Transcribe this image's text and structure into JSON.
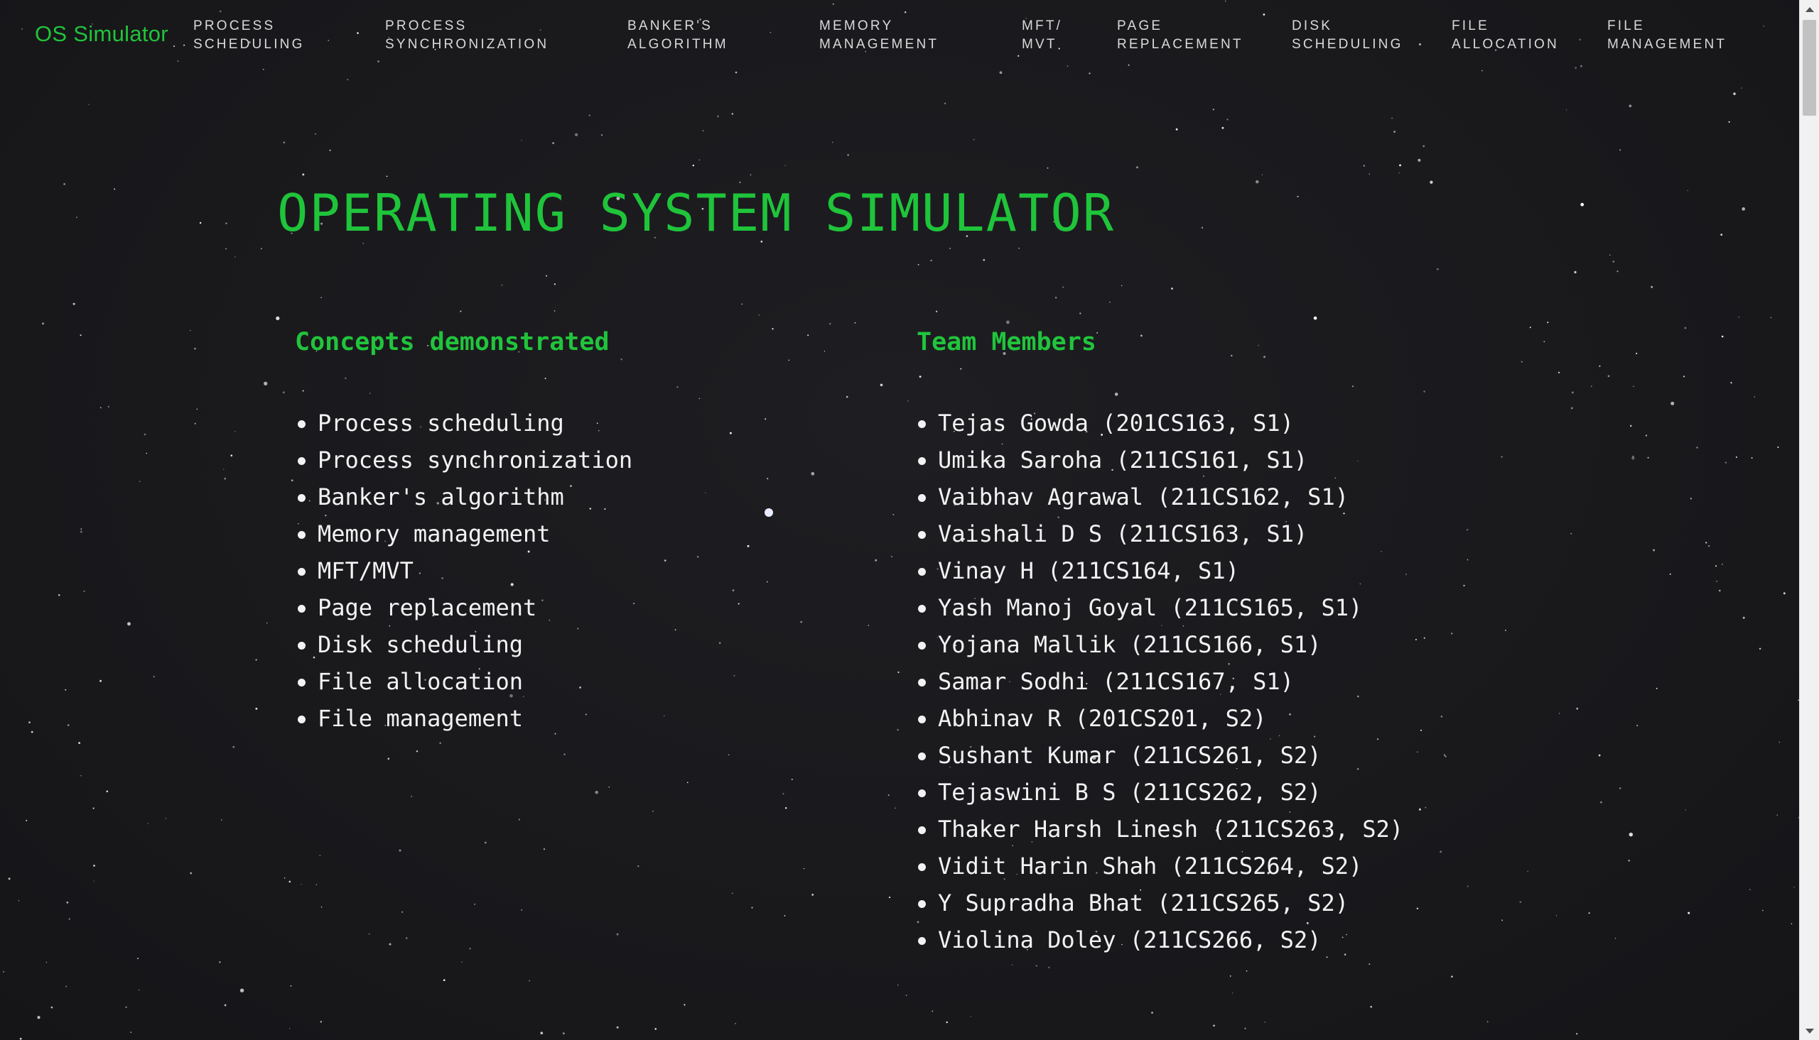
{
  "navbar": {
    "brand": "OS Simulator",
    "links": [
      {
        "label": "Process\nScheduling"
      },
      {
        "label": "Process\nSynchronization"
      },
      {
        "label": "Banker's\nAlgorithm"
      },
      {
        "label": "Memory\nManagement"
      },
      {
        "label": "MFT/\nMVT"
      },
      {
        "label": "Page\nReplacement"
      },
      {
        "label": "Disk\nScheduling"
      },
      {
        "label": "File\nAllocation"
      },
      {
        "label": "File\nManagement"
      }
    ]
  },
  "main": {
    "title": "OPERATING SYSTEM SIMULATOR",
    "concepts": {
      "heading": "Concepts demonstrated",
      "items": [
        "Process scheduling",
        "Process synchronization",
        "Banker's algorithm",
        "Memory management",
        "MFT/MVT",
        "Page replacement",
        "Disk scheduling",
        "File allocation",
        "File management"
      ]
    },
    "team": {
      "heading": "Team Members",
      "members": [
        "Tejas Gowda (201CS163, S1)",
        "Umika Saroha (211CS161, S1)",
        "Vaibhav Agrawal (211CS162, S1)",
        "Vaishali D S (211CS163, S1)",
        "Vinay H (211CS164, S1)",
        "Yash Manoj Goyal (211CS165, S1)",
        "Yojana Mallik (211CS166, S1)",
        "Samar Sodhi (211CS167, S1)",
        "Abhinav R (201CS201, S2)",
        "Sushant Kumar (211CS261, S2)",
        "Tejaswini B S (211CS262, S2)",
        "Thaker Harsh Linesh (211CS263, S2)",
        "Vidit Harin Shah (211CS264, S2)",
        "Y Supradha Bhat (211CS265, S2)",
        "Violina Doley (211CS266, S2)"
      ]
    }
  },
  "colors": {
    "accent": "#22c33a",
    "background": "#1a1a1d",
    "text": "#f2f2f2",
    "nav_text": "#d9d9d9"
  },
  "icons": [
    "scroll-up-arrow-icon",
    "scroll-down-arrow-icon"
  ]
}
